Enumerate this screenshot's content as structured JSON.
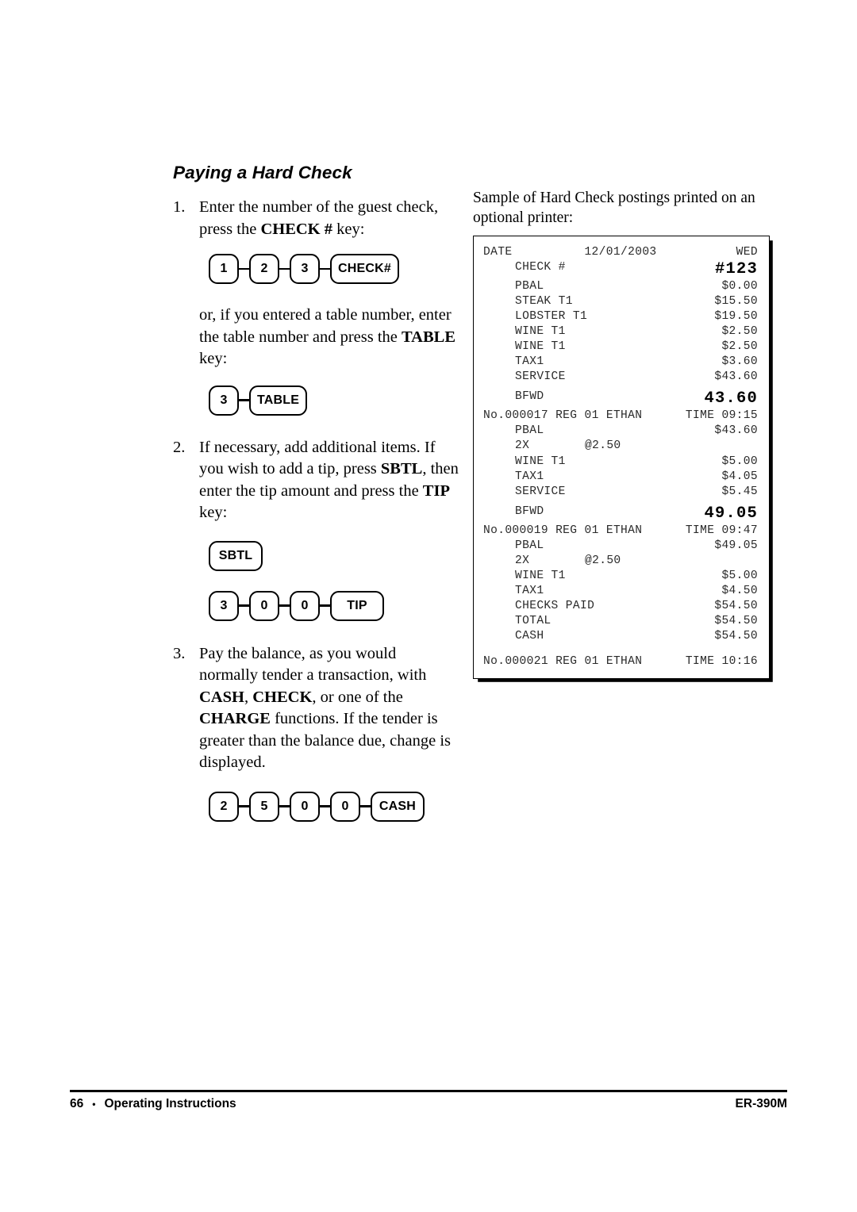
{
  "section": {
    "title": "Paying a Hard Check"
  },
  "steps": {
    "s1": {
      "num": "1.",
      "text_a": "Enter the number of the guest check, press the ",
      "text_b": "CHECK #",
      "text_c": " key:",
      "keys": [
        "1",
        "2",
        "3",
        "CHECK#"
      ]
    },
    "alt": {
      "text_a": "or, if you entered a table number, enter the table number and press the ",
      "text_b": "TABLE",
      "text_c": " key:",
      "keys": [
        "3",
        "TABLE"
      ]
    },
    "s2": {
      "num": "2.",
      "text_a": "If necessary, add additional items.   If you wish to add a tip, press ",
      "text_b": "SBTL",
      "text_c": ", then enter the tip amount and press the ",
      "text_d": "TIP",
      "text_e": " key:",
      "single_key": "SBTL",
      "keys": [
        "3",
        "0",
        "0",
        "TIP"
      ]
    },
    "s3": {
      "num": "3.",
      "text_a": "Pay the balance, as you would normally tender a transaction, with ",
      "text_b": "CASH",
      "text_c": ", ",
      "text_d": "CHECK",
      "text_e": ", or one of the ",
      "text_f": "CHARGE",
      "text_g": " functions.   If the tender is greater than the balance due, change is displayed.",
      "keys": [
        "2",
        "5",
        "0",
        "0",
        "CASH"
      ]
    }
  },
  "sample": {
    "caption": "Sample of Hard Check postings printed on an optional printer:",
    "receipt": {
      "header": {
        "left": "DATE",
        "center": "12/01/2003",
        "right": "WED"
      },
      "lines": [
        {
          "type": "big",
          "label": "CHECK #",
          "amount": "#123"
        },
        {
          "type": "item",
          "label": "PBAL",
          "amount": "$0.00"
        },
        {
          "type": "item",
          "label": "STEAK T1",
          "amount": "$15.50"
        },
        {
          "type": "item",
          "label": "LOBSTER T1",
          "amount": "$19.50"
        },
        {
          "type": "item",
          "label": "WINE T1",
          "amount": "$2.50"
        },
        {
          "type": "item",
          "label": "WINE T1",
          "amount": "$2.50"
        },
        {
          "type": "item",
          "label": "TAX1",
          "amount": "$3.60"
        },
        {
          "type": "item",
          "label": "SERVICE",
          "amount": "$43.60"
        },
        {
          "type": "gap"
        },
        {
          "type": "big",
          "label": "BFWD",
          "amount": "43.60"
        },
        {
          "type": "footerline",
          "left": "No.000017 REG 01 ETHAN",
          "right": "TIME 09:15"
        },
        {
          "type": "item",
          "label": "PBAL",
          "amount": "$43.60"
        },
        {
          "type": "qty",
          "qty": "2X",
          "unit": "@2.50",
          "amount": ""
        },
        {
          "type": "item",
          "label": "WINE T1",
          "amount": "$5.00"
        },
        {
          "type": "item",
          "label": "TAX1",
          "amount": "$4.05"
        },
        {
          "type": "item",
          "label": "SERVICE",
          "amount": "$5.45"
        },
        {
          "type": "gap"
        },
        {
          "type": "big",
          "label": "BFWD",
          "amount": "49.05"
        },
        {
          "type": "footerline",
          "left": "No.000019 REG 01 ETHAN",
          "right": "TIME 09:47"
        },
        {
          "type": "item",
          "label": "PBAL",
          "amount": "$49.05"
        },
        {
          "type": "qty",
          "qty": "2X",
          "unit": "@2.50",
          "amount": ""
        },
        {
          "type": "item",
          "label": "WINE T1",
          "amount": "$5.00"
        },
        {
          "type": "item",
          "label": "TAX1",
          "amount": "$4.50"
        },
        {
          "type": "item",
          "label": "CHECKS PAID",
          "amount": "$54.50"
        },
        {
          "type": "item",
          "label": "TOTAL",
          "amount": "$54.50"
        },
        {
          "type": "item",
          "label": "CASH",
          "amount": "$54.50"
        },
        {
          "type": "gap-lg"
        },
        {
          "type": "footerline",
          "left": "No.000021 REG 01 ETHAN",
          "right": "TIME 10:16"
        }
      ]
    }
  },
  "footer": {
    "page_number": "66",
    "separator": "•",
    "section_label": "Operating Instructions",
    "model": "ER-390M"
  }
}
